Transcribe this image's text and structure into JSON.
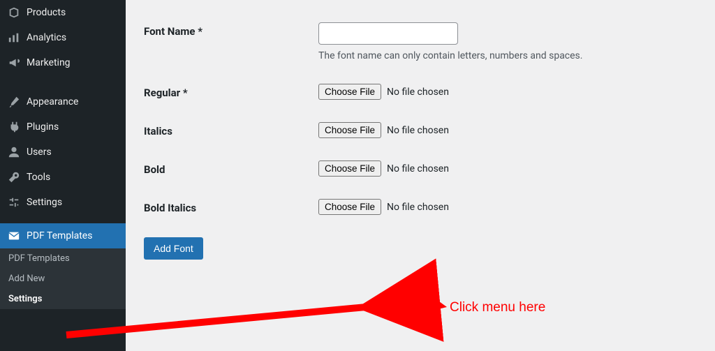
{
  "sidebar": {
    "items": [
      {
        "label": "Products",
        "icon": "box"
      },
      {
        "label": "Analytics",
        "icon": "bars"
      },
      {
        "label": "Marketing",
        "icon": "megaphone"
      },
      {
        "label": "Appearance",
        "icon": "brush"
      },
      {
        "label": "Plugins",
        "icon": "plug"
      },
      {
        "label": "Users",
        "icon": "user"
      },
      {
        "label": "Tools",
        "icon": "wrench"
      },
      {
        "label": "Settings",
        "icon": "sliders"
      },
      {
        "label": "PDF Templates",
        "icon": "mail"
      }
    ],
    "submenu": [
      {
        "label": "PDF Templates"
      },
      {
        "label": "Add New"
      },
      {
        "label": "Settings"
      }
    ]
  },
  "form": {
    "font_name_label": "Font Name *",
    "font_name_help": "The font name can only contain letters, numbers and spaces.",
    "regular_label": "Regular *",
    "italics_label": "Italics",
    "bold_label": "Bold",
    "bold_italics_label": "Bold Italics",
    "choose_file": "Choose File",
    "no_file": "No file chosen",
    "add_font": "Add Font"
  },
  "annotation": {
    "text": "Click menu here"
  }
}
